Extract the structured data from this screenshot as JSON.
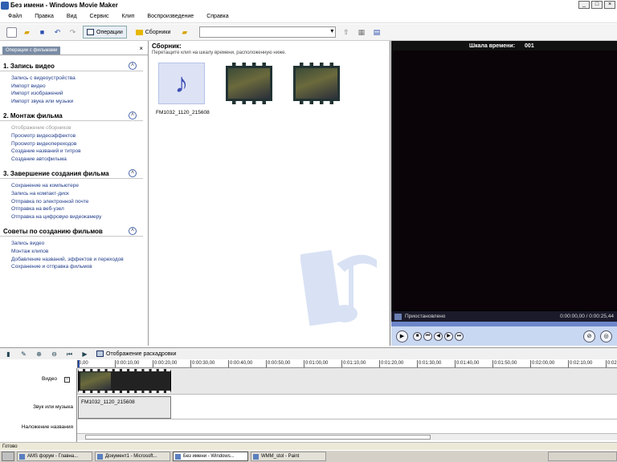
{
  "window": {
    "title": "Без имени - Windows Movie Maker"
  },
  "menu": [
    "Файл",
    "Правка",
    "Вид",
    "Сервис",
    "Клип",
    "Воспроизведение",
    "Справка"
  ],
  "toolbar": {
    "operations_label": "Операции",
    "collections_label": "Сборники"
  },
  "task_pane": {
    "tab_label": "Операции с фильмами",
    "sections": [
      {
        "title": "1. Запись видео",
        "items": [
          {
            "label": "Запись с видеоустройства",
            "disabled": false
          },
          {
            "label": "Импорт видео",
            "disabled": false
          },
          {
            "label": "Импорт изображений",
            "disabled": false
          },
          {
            "label": "Импорт звука или музыки",
            "disabled": false
          }
        ]
      },
      {
        "title": "2. Монтаж фильма",
        "items": [
          {
            "label": "Отображение сборников",
            "disabled": true
          },
          {
            "label": "Просмотр видеоэффектов",
            "disabled": false
          },
          {
            "label": "Просмотр видеопереходов",
            "disabled": false
          },
          {
            "label": "Создание названий и титров",
            "disabled": false
          },
          {
            "label": "Создание автофильма",
            "disabled": false
          }
        ]
      },
      {
        "title": "3. Завершение создания фильма",
        "items": [
          {
            "label": "Сохранение на компьютере",
            "disabled": false
          },
          {
            "label": "Запись на компакт-диск",
            "disabled": false
          },
          {
            "label": "Отправка по электронной почте",
            "disabled": false
          },
          {
            "label": "Отправка на веб-узел",
            "disabled": false
          },
          {
            "label": "Отправка на цифровую видеокамеру",
            "disabled": false
          }
        ]
      },
      {
        "title": "Советы по созданию фильмов",
        "items": [
          {
            "label": "Запись видео",
            "disabled": false
          },
          {
            "label": "Монтаж клипов",
            "disabled": false
          },
          {
            "label": "Добавление названий, эффектов и переходов",
            "disabled": false
          },
          {
            "label": "Сохранение и отправка фильмов",
            "disabled": false
          }
        ]
      }
    ]
  },
  "collection": {
    "title": "Сборник:",
    "subtitle": "Перетащите клип на шкалу времени, расположенную ниже.",
    "audio_clip_label": "FM1032_1120_215608"
  },
  "preview": {
    "header_label": "Шкала времени:",
    "header_value": "001",
    "status": "Приостановлено",
    "time": "0:00:00,00 / 0:00:25,44",
    "progress": 0
  },
  "timeline": {
    "storyboard_label": "Отображение раскадровки",
    "ticks": [
      "0,00",
      "0:00:10,00",
      "0:00:20,00",
      "0:00:30,00",
      "0:00:40,00",
      "0:00:50,00",
      "0:01:00,00",
      "0:01:10,00",
      "0:01:20,00",
      "0:01:30,00",
      "0:01:40,00",
      "0:01:50,00",
      "0:02:00,00",
      "0:02:10,00",
      "0:02:20,00"
    ],
    "track_video": "Видео",
    "track_audio": "Звук или музыка",
    "track_title": "Наложение названия",
    "audio_clip_label": "FM1032_1120_215608"
  },
  "status_bar": {
    "text": "Готово"
  },
  "taskbar": {
    "items": [
      "AMS форум - Главна...",
      "Документ1 - Microsoft...",
      "Без имени - Windows...",
      "WMM_stol - Paint"
    ],
    "active_index": 2
  }
}
